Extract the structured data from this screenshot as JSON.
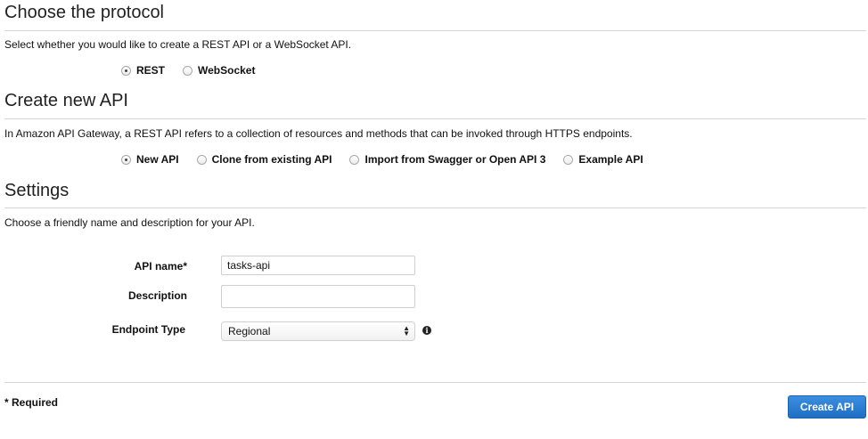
{
  "protocol": {
    "title": "Choose the protocol",
    "description": "Select whether you would like to create a REST API or a WebSocket API.",
    "options": [
      {
        "label": "REST",
        "checked": true
      },
      {
        "label": "WebSocket",
        "checked": false
      }
    ]
  },
  "create": {
    "title": "Create new API",
    "description": "In Amazon API Gateway, a REST API refers to a collection of resources and methods that can be invoked through HTTPS endpoints.",
    "options": [
      {
        "label": "New API",
        "checked": true
      },
      {
        "label": "Clone from existing API",
        "checked": false
      },
      {
        "label": "Import from Swagger or Open API 3",
        "checked": false
      },
      {
        "label": "Example API",
        "checked": false
      }
    ]
  },
  "settings": {
    "title": "Settings",
    "description": "Choose a friendly name and description for your API.",
    "api_name": {
      "label": "API name*",
      "value": "tasks-api",
      "placeholder": ""
    },
    "description_field": {
      "label": "Description",
      "value": "",
      "placeholder": ""
    },
    "endpoint_type": {
      "label": "Endpoint Type",
      "selected": "Regional"
    }
  },
  "footer": {
    "required_note": "* Required",
    "create_button": "Create API"
  },
  "icons": {
    "info": "info-icon",
    "select_arrows": "chevron-up-down-icon"
  },
  "colors": {
    "primary_button": "#1f6fc4",
    "rule": "#d5d5d5"
  }
}
